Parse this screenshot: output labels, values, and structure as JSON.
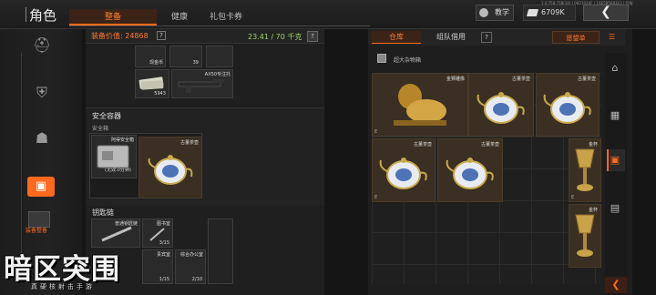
{
  "header": {
    "title": "角色",
    "tabs": [
      "整备",
      "健康",
      "礼包卡券"
    ],
    "active_tab": "整备",
    "version_text": "1.0.758.758(10) | 0821034F | 1AE5B5683E3 | 官服",
    "tutorial_label": "教学",
    "currency_value": "6709K",
    "back_icon": "chevron-left-icon"
  },
  "equipment": {
    "value_label": "装备价值: 24868",
    "weight_label": "23.41 / 70 千克",
    "top_slots": [
      {
        "tag": "",
        "count": "39"
      },
      {
        "tag": "现金币",
        "count": ""
      },
      {
        "tag": "",
        "count": "5943"
      },
      {
        "tag": "AX50专注托",
        "count": ""
      }
    ],
    "safe_section": {
      "heading": "安全容器",
      "subheading": "安全箱",
      "container": {
        "tag": "阿得安全箱",
        "note": "(无效:0分钟)"
      },
      "item": {
        "tag": "古董茶壶"
      }
    },
    "keychain_section": {
      "heading": "钥匙链",
      "slots": [
        {
          "tag": "普通钥匙链",
          "count": ""
        },
        {
          "tag": "图书室",
          "count": "3/15"
        },
        {
          "tag": "贵宾室",
          "count": "1/15"
        },
        {
          "tag": "综合办公室",
          "count": "2/10"
        }
      ]
    }
  },
  "storage": {
    "tabs": [
      "仓库",
      "组队借用"
    ],
    "active_tab": "仓库",
    "wishlist_label": "愿望单",
    "crate_label": "超大杂物箱",
    "items": [
      {
        "name": "金狮雕像",
        "mark": "E"
      },
      {
        "name": "古董茶壶",
        "mark": ""
      },
      {
        "name": "古董茶壶",
        "mark": ""
      },
      {
        "name": "古董茶壶",
        "mark": "E"
      },
      {
        "name": "古董茶壶",
        "mark": ""
      },
      {
        "name": "金杯",
        "mark": "E"
      },
      {
        "name": "金杯",
        "mark": ""
      }
    ]
  },
  "sidebar": {
    "active_label": "装备整备"
  },
  "logo": {
    "title": "暗区突围",
    "subtitle": "真硬核射击手游"
  },
  "colors": {
    "accent": "#ff6a1f",
    "weight_ok": "#9fd16a",
    "background": "#151515"
  }
}
